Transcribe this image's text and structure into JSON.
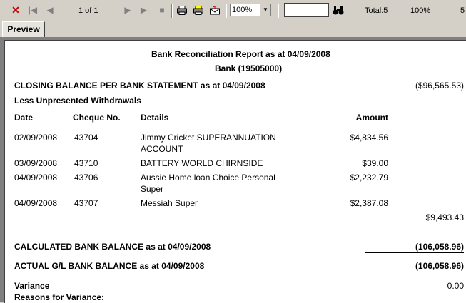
{
  "toolbar": {
    "page_indicator": "1 of 1",
    "zoom": "100%",
    "search_value": "",
    "total_label": "Total:5",
    "percent_label": "100%",
    "trailing_label": "5"
  },
  "tab": {
    "label": "Preview"
  },
  "report": {
    "title": "Bank Reconciliation Report as at 04/09/2008",
    "subtitle": "Bank (19505000)",
    "closing_label": "CLOSING BALANCE PER BANK STATEMENT as at 04/09/2008",
    "closing_value": "($96,565.53)",
    "less_label": "Less Unpresented Withdrawals",
    "columns": {
      "date": "Date",
      "cheque": "Cheque No.",
      "details": "Details",
      "amount": "Amount"
    },
    "rows": [
      {
        "date": "02/09/2008",
        "cheque": "43704",
        "details1": "Jimmy Cricket SUPERANNUATION",
        "details2": "ACCOUNT",
        "amount": "$4,834.56"
      },
      {
        "date": "03/09/2008",
        "cheque": "43710",
        "details1": "BATTERY WORLD CHIRNSIDE",
        "details2": "",
        "amount": "$39.00"
      },
      {
        "date": "04/09/2008",
        "cheque": "43706",
        "details1": "Aussie Home loan Choice Personal",
        "details2": "Super",
        "amount": "$2,232.79"
      },
      {
        "date": "04/09/2008",
        "cheque": "43707",
        "details1": "Messiah Super",
        "details2": "",
        "amount": "$2,387.08"
      }
    ],
    "withdrawals_total": "$9,493.43",
    "calculated_label": "CALCULATED BANK BALANCE as at 04/09/2008",
    "calculated_value": "(106,058.96)",
    "actual_label": "ACTUAL G/L BANK BALANCE as at 04/09/2008",
    "actual_value": "(106,058.96)",
    "variance_label": "Variance",
    "variance_value": "0.00",
    "reasons_label": "Reasons for Variance:"
  },
  "icons": [
    "close-icon",
    "first-page-icon",
    "prev-page-icon",
    "next-page-icon",
    "last-page-icon",
    "stop-icon",
    "print-icon",
    "print-setup-icon",
    "export-icon",
    "find-icon"
  ],
  "colors": {
    "close": "#c00000",
    "chrome": "#d4d0c8"
  }
}
